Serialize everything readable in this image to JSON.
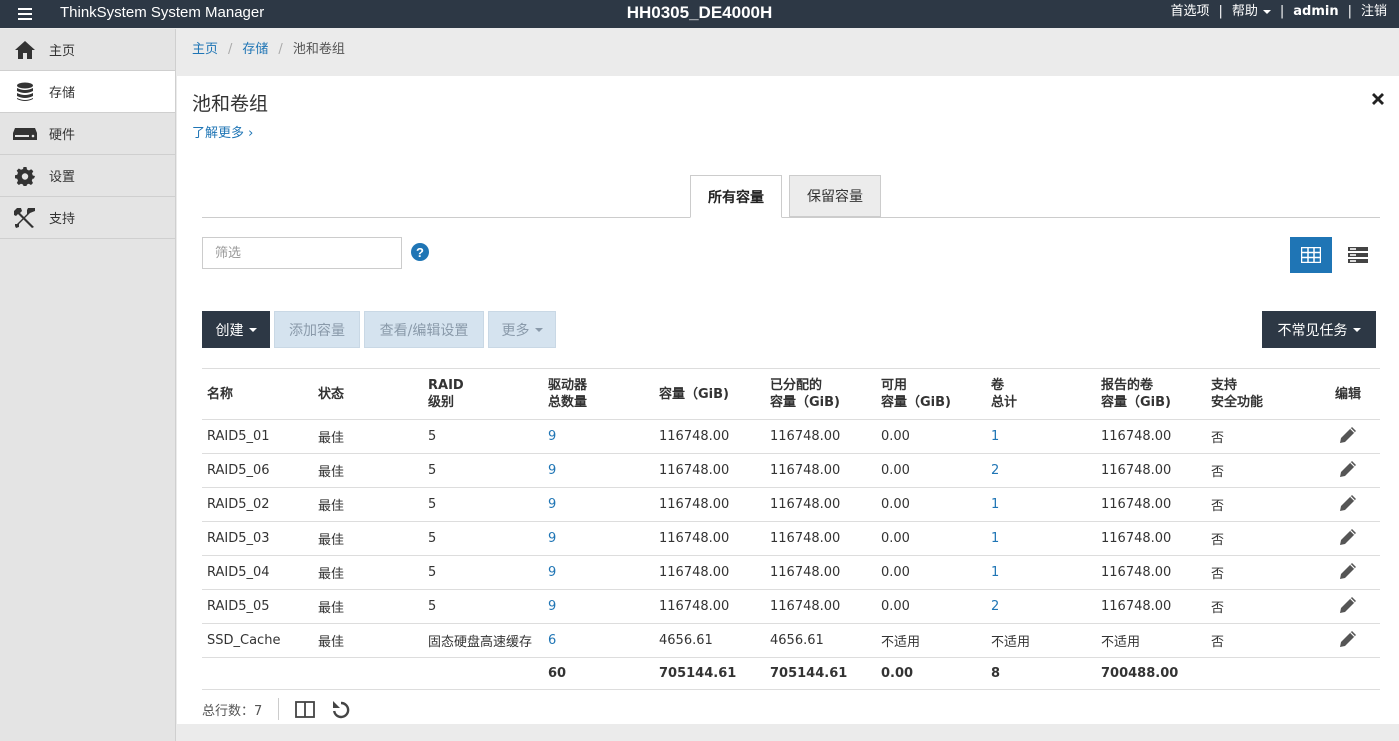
{
  "topbar": {
    "app_name": "ThinkSystem System Manager",
    "system_name": "HH0305_DE4000H",
    "preferences": "首选项",
    "help": "帮助",
    "user": "admin",
    "logout": "注销"
  },
  "sidebar": {
    "items": [
      {
        "label": "主页",
        "icon": "home-icon"
      },
      {
        "label": "存储",
        "icon": "database-icon"
      },
      {
        "label": "硬件",
        "icon": "hardware-icon"
      },
      {
        "label": "设置",
        "icon": "gear-icon"
      },
      {
        "label": "支持",
        "icon": "tools-icon"
      }
    ],
    "active_index": 1
  },
  "breadcrumb": {
    "home": "主页",
    "storage": "存储",
    "current": "池和卷组"
  },
  "page": {
    "title": "池和卷组",
    "learn_more": "了解更多 ›"
  },
  "tabs": {
    "all_capacity": "所有容量",
    "reserved_capacity": "保留容量"
  },
  "filter": {
    "placeholder": "筛选",
    "value": ""
  },
  "help_icon": "?",
  "toolbar": {
    "create": "创建",
    "add_capacity": "添加容量",
    "view_edit": "查看/编辑设置",
    "more": "更多",
    "uncommon_tasks": "不常见任务"
  },
  "table": {
    "headers": {
      "name": "名称",
      "status": "状态",
      "raid_1": "RAID",
      "raid_2": "级别",
      "drives_1": "驱动器",
      "drives_2": "总数量",
      "capacity": "容量（GiB)",
      "allocated_1": "已分配的",
      "allocated_2": "容量（GiB)",
      "free_1": "可用",
      "free_2": "容量（GiB)",
      "volumes_1": "卷",
      "volumes_2": "总计",
      "reported_1": "报告的卷",
      "reported_2": "容量（GiB)",
      "security_1": "支持",
      "security_2": "安全功能",
      "edit": "编辑"
    },
    "rows": [
      {
        "name": "RAID5_01",
        "status": "最佳",
        "raid": "5",
        "drives": "9",
        "capacity": "116748.00",
        "allocated": "116748.00",
        "free": "0.00",
        "volumes": "1",
        "reported": "116748.00",
        "secure": "否"
      },
      {
        "name": "RAID5_06",
        "status": "最佳",
        "raid": "5",
        "drives": "9",
        "capacity": "116748.00",
        "allocated": "116748.00",
        "free": "0.00",
        "volumes": "2",
        "reported": "116748.00",
        "secure": "否"
      },
      {
        "name": "RAID5_02",
        "status": "最佳",
        "raid": "5",
        "drives": "9",
        "capacity": "116748.00",
        "allocated": "116748.00",
        "free": "0.00",
        "volumes": "1",
        "reported": "116748.00",
        "secure": "否"
      },
      {
        "name": "RAID5_03",
        "status": "最佳",
        "raid": "5",
        "drives": "9",
        "capacity": "116748.00",
        "allocated": "116748.00",
        "free": "0.00",
        "volumes": "1",
        "reported": "116748.00",
        "secure": "否"
      },
      {
        "name": "RAID5_04",
        "status": "最佳",
        "raid": "5",
        "drives": "9",
        "capacity": "116748.00",
        "allocated": "116748.00",
        "free": "0.00",
        "volumes": "1",
        "reported": "116748.00",
        "secure": "否"
      },
      {
        "name": "RAID5_05",
        "status": "最佳",
        "raid": "5",
        "drives": "9",
        "capacity": "116748.00",
        "allocated": "116748.00",
        "free": "0.00",
        "volumes": "2",
        "reported": "116748.00",
        "secure": "否"
      },
      {
        "name": "SSD_Cache",
        "status": "最佳",
        "raid": "固态硬盘高速缓存",
        "drives": "6",
        "capacity": "4656.61",
        "allocated": "4656.61",
        "free": "不适用",
        "volumes": "不适用",
        "reported": "不适用",
        "secure": "否"
      }
    ],
    "totals": {
      "drives": "60",
      "capacity": "705144.61",
      "allocated": "705144.61",
      "free": "0.00",
      "volumes": "8",
      "reported": "700488.00"
    }
  },
  "footer": {
    "row_count": "总行数：7"
  },
  "colors": {
    "topbar": "#2d3845",
    "accent": "#1f75b5",
    "sidebar": "#e4e4e4"
  }
}
